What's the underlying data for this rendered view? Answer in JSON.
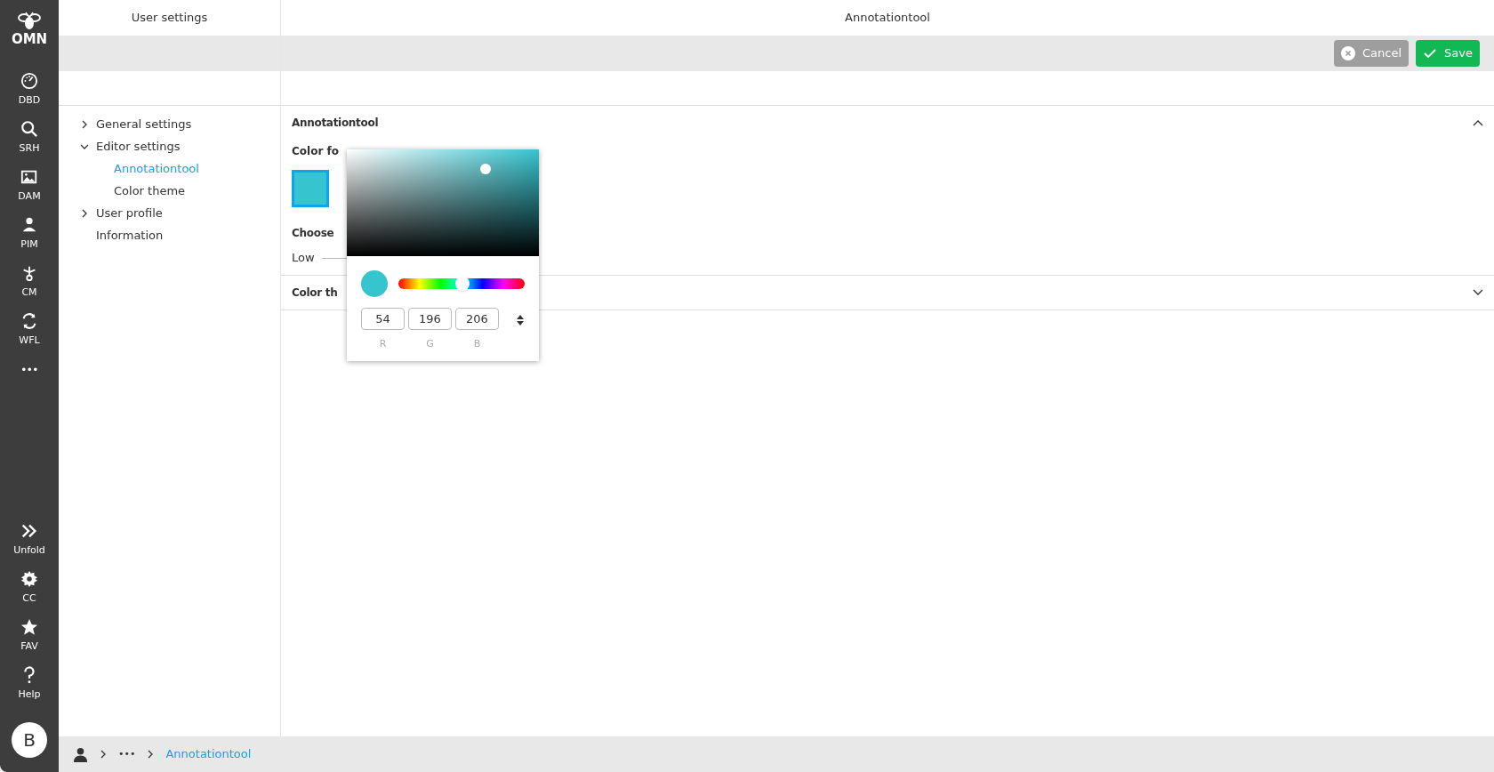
{
  "sidebar": {
    "logo": "OMN",
    "items": [
      {
        "label": "DBD"
      },
      {
        "label": "SRH"
      },
      {
        "label": "DAM"
      },
      {
        "label": "PIM"
      },
      {
        "label": "CM"
      },
      {
        "label": "WFL"
      }
    ],
    "more": "•••",
    "bottom_items": [
      {
        "label": "Unfold"
      },
      {
        "label": "CC"
      },
      {
        "label": "FAV"
      },
      {
        "label": "Help"
      }
    ],
    "avatar": "B"
  },
  "left_panel": {
    "title": "User settings",
    "tree": [
      {
        "label": "General settings",
        "expanded": false,
        "selected": false
      },
      {
        "label": "Editor settings",
        "expanded": true,
        "selected": false,
        "children": [
          {
            "label": "Annotationtool",
            "selected": true
          },
          {
            "label": "Color theme",
            "selected": false
          }
        ]
      },
      {
        "label": "User profile",
        "expanded": false,
        "selected": false
      },
      {
        "label": "Information",
        "selected": false
      }
    ]
  },
  "main": {
    "title": "Annotationtool",
    "buttons": [
      {
        "kind": "cancel",
        "label": "Cancel"
      },
      {
        "kind": "save",
        "label": "Save"
      }
    ],
    "sections": [
      {
        "title": "Annotationtool",
        "expanded": true,
        "fields": [
          {
            "label": "Color fo"
          },
          {
            "label": "Choose",
            "slider_label": "Low"
          }
        ]
      },
      {
        "title": "Color th",
        "expanded": false
      }
    ]
  },
  "color_picker": {
    "hue_level": {
      "level": 0.51
    },
    "channels": [
      {
        "value": "54",
        "label": "R"
      },
      {
        "value": "196",
        "label": "G"
      },
      {
        "value": "206",
        "label": "B"
      }
    ]
  },
  "breadcrumb": {
    "more": "•••",
    "current": "Annotationtool"
  }
}
